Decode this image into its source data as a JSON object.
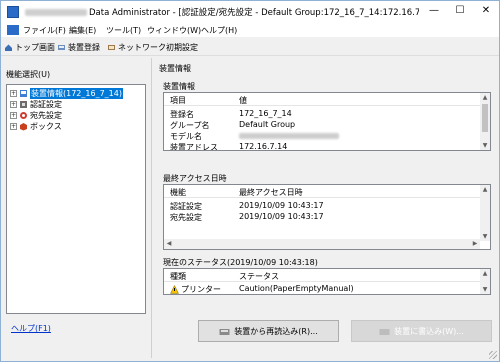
{
  "window": {
    "title_prefix_hidden": "",
    "title": "Data Administrator - [認証設定/宛先設定 - Default Group:172_16_7_14:172.16.7.14 - 装...",
    "minimize": "—",
    "maximize": "☐",
    "close": "✕"
  },
  "menu": {
    "file": "ファイル(F)",
    "edit": "編集(E)",
    "tools": "ツール(T)",
    "window": "ウィンドウ(W)",
    "help": "ヘルプ(H)"
  },
  "toolbar": {
    "top": "トップ画面",
    "register": "装置登録",
    "network": "ネットワーク初期設定"
  },
  "left": {
    "function_label": "機能選択(U)",
    "tree": [
      {
        "label": "装置情報(172_16_7_14)",
        "selected": true
      },
      {
        "label": "認証設定",
        "selected": false
      },
      {
        "label": "宛先設定",
        "selected": false
      },
      {
        "label": "ボックス",
        "selected": false
      }
    ],
    "help_link": "ヘルプ(F1)"
  },
  "right": {
    "header": "装置情報",
    "device_info": {
      "title": "装置情報",
      "col1": "項目",
      "col2": "値",
      "rows": [
        {
          "k": "登録名",
          "v": "172_16_7_14"
        },
        {
          "k": "グループ名",
          "v": "Default Group"
        },
        {
          "k": "モデル名",
          "v": ""
        },
        {
          "k": "装置アドレス",
          "v": "172.16.7.14"
        }
      ]
    },
    "access": {
      "title": "最終アクセス日時",
      "col1": "機能",
      "col2": "最終アクセス日時",
      "rows": [
        {
          "k": "認証設定",
          "v": "2019/10/09 10:43:17"
        },
        {
          "k": "宛先設定",
          "v": "2019/10/09 10:43:17"
        }
      ]
    },
    "status": {
      "title": "現在のステータス(2019/10/09 10:43:18)",
      "col1": "種類",
      "col2": "ステータス",
      "rows": [
        {
          "k": "プリンター",
          "v": "Caution(PaperEmptyManual)"
        }
      ]
    },
    "reload_button": "装置から再読込み(R)...",
    "write_button": "装置に書込み(W)..."
  }
}
